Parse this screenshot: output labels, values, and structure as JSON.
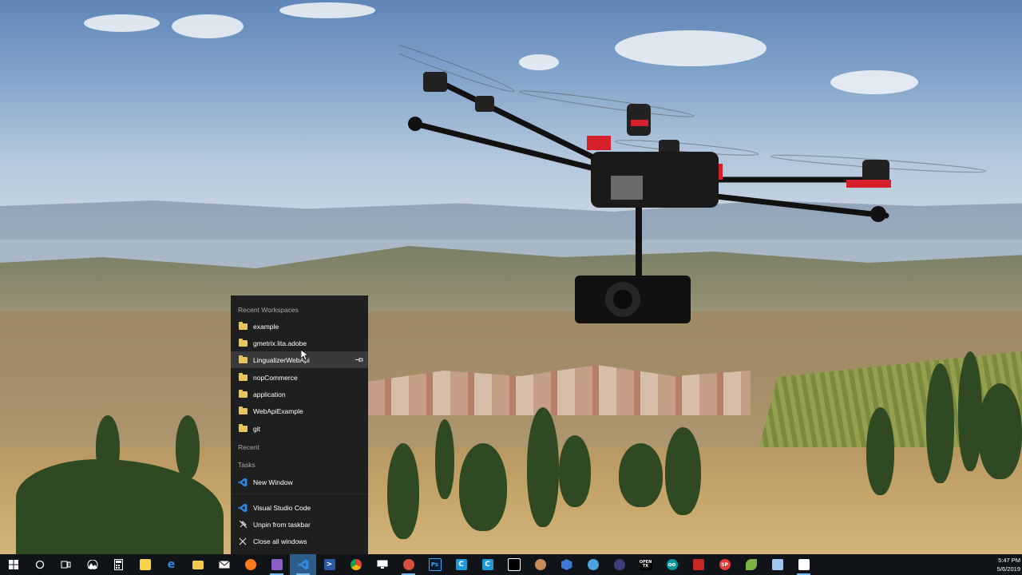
{
  "jumplist": {
    "recent_workspaces_header": "Recent Workspaces",
    "workspaces": [
      {
        "label": "example",
        "icon": "folder-icon"
      },
      {
        "label": "gmetrix.lita.adobe",
        "icon": "folder-icon"
      },
      {
        "label": "LingualizerWebApi",
        "icon": "folder-icon",
        "hovered": true,
        "pin_icon": "pin-icon"
      },
      {
        "label": "nopCommerce",
        "icon": "folder-icon"
      },
      {
        "label": "application",
        "icon": "folder-icon"
      },
      {
        "label": "WebApiExample",
        "icon": "folder-icon"
      },
      {
        "label": "git",
        "icon": "folder-icon"
      }
    ],
    "recent_header": "Recent",
    "tasks_header": "Tasks",
    "tasks": [
      {
        "label": "New Window",
        "icon": "vscode-icon"
      }
    ],
    "app_actions": [
      {
        "label": "Visual Studio Code",
        "icon": "vscode-icon"
      },
      {
        "label": "Unpin from taskbar",
        "icon": "unpin-icon"
      },
      {
        "label": "Close all windows",
        "icon": "close-icon"
      }
    ]
  },
  "taskbar": {
    "icons": [
      {
        "name": "start-icon",
        "color": "#ffffff"
      },
      {
        "name": "search-icon",
        "color": "#ffffff"
      },
      {
        "name": "task-view-icon",
        "color": "#ffffff"
      },
      {
        "name": "photos-icon",
        "color": "#ffffff"
      },
      {
        "name": "calculator-icon",
        "color": "#ffffff"
      },
      {
        "name": "sticky-notes-icon",
        "color": "#f7d44a"
      },
      {
        "name": "edge-icon",
        "color": "#2f8be0"
      },
      {
        "name": "file-explorer-icon",
        "color": "#f2c94c"
      },
      {
        "name": "mail-icon",
        "color": "#ffffff"
      },
      {
        "name": "firefox-icon",
        "color": "#ff7a1a"
      },
      {
        "name": "visual-studio-icon",
        "color": "#8a5fc7"
      },
      {
        "name": "vscode-icon",
        "color": "#2f8be0",
        "active": true
      },
      {
        "name": "powershell-icon",
        "color": "#2a5aa6"
      },
      {
        "name": "chrome-icon",
        "color": "#db4437"
      },
      {
        "name": "monitor-icon",
        "color": "#ffffff"
      },
      {
        "name": "settings-gear-icon",
        "color": "#d94f3d"
      },
      {
        "name": "photoshop-icon",
        "color": "#31a8ff",
        "text": "Ps"
      },
      {
        "name": "cortana-c-icon",
        "color": "#1e9bd7",
        "text": "C"
      },
      {
        "name": "c-app-icon",
        "color": "#1e9bd7",
        "text": "C"
      },
      {
        "name": "terminal-icon",
        "color": "#ffffff"
      },
      {
        "name": "avatar-app-icon",
        "color": "#c98a5a"
      },
      {
        "name": "hexagon-app-icon",
        "color": "#3a7bd5"
      },
      {
        "name": "chat-app-icon",
        "color": "#4aa3df"
      },
      {
        "name": "eclipse-icon",
        "color": "#3b3f7a"
      },
      {
        "name": "opentx-icon",
        "color": "#ffffff",
        "text": "OPEN TX"
      },
      {
        "name": "arduino-icon",
        "color": "#00979c",
        "text": "oo"
      },
      {
        "name": "filezilla-icon",
        "color": "#c62828"
      },
      {
        "name": "red-app-icon",
        "color": "#e53935",
        "text": "SP"
      },
      {
        "name": "green-leaf-icon",
        "color": "#7cb342"
      },
      {
        "name": "network-app-icon",
        "color": "#9ec7ef"
      },
      {
        "name": "settings-app-icon",
        "color": "#ffffff"
      }
    ],
    "clock_time": "5:47 PM",
    "clock_date": "5/6/2019"
  }
}
